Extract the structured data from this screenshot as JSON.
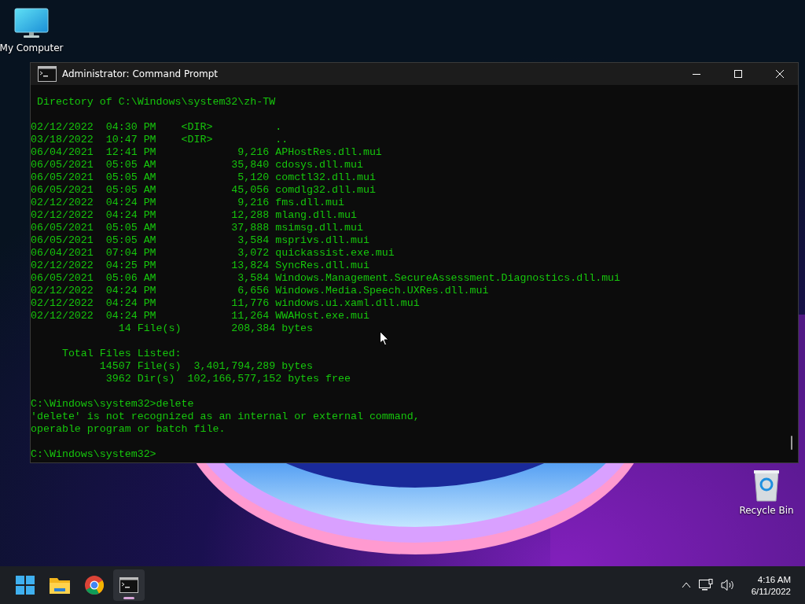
{
  "desktop_icons": [
    {
      "kind": "monitor",
      "label": "My Computer"
    },
    {
      "kind": "bin",
      "label": "Recycle Bin"
    }
  ],
  "window": {
    "title": "Administrator: Command Prompt",
    "console_blocks": [
      [
        " Directory of C:\\Windows\\system32\\zh-TW"
      ],
      [
        "02/12/2022  04:30 PM    <DIR>          .",
        "03/18/2022  10:47 PM    <DIR>          ..",
        "06/04/2021  12:41 PM             9,216 APHostRes.dll.mui",
        "06/05/2021  05:05 AM            35,840 cdosys.dll.mui",
        "06/05/2021  05:05 AM             5,120 comctl32.dll.mui",
        "06/05/2021  05:05 AM            45,056 comdlg32.dll.mui",
        "02/12/2022  04:24 PM             9,216 fms.dll.mui",
        "02/12/2022  04:24 PM            12,288 mlang.dll.mui",
        "06/05/2021  05:05 AM            37,888 msimsg.dll.mui",
        "06/05/2021  05:05 AM             3,584 msprivs.dll.mui",
        "06/04/2021  07:04 PM             3,072 quickassist.exe.mui",
        "02/12/2022  04:25 PM            13,824 SyncRes.dll.mui",
        "06/05/2021  05:06 AM             3,584 Windows.Management.SecureAssessment.Diagnostics.dll.mui",
        "02/12/2022  04:24 PM             6,656 Windows.Media.Speech.UXRes.dll.mui",
        "02/12/2022  04:24 PM            11,776 windows.ui.xaml.dll.mui",
        "02/12/2022  04:24 PM            11,264 WWAHost.exe.mui",
        "              14 File(s)        208,384 bytes"
      ],
      [
        "     Total Files Listed:",
        "           14507 File(s)  3,401,794,289 bytes",
        "            3962 Dir(s)  102,166,577,152 bytes free"
      ],
      [
        "C:\\Windows\\system32>delete",
        "'delete' is not recognized as an internal or external command,",
        "operable program or batch file."
      ],
      [
        "C:\\Windows\\system32>"
      ]
    ]
  },
  "taskbar": {
    "items": [
      {
        "kind": "start",
        "selected": false
      },
      {
        "kind": "folder",
        "selected": false
      },
      {
        "kind": "browser",
        "selected": false
      },
      {
        "kind": "terminal",
        "selected": true
      }
    ],
    "time": "4:16 AM",
    "date": "6/11/2022"
  }
}
